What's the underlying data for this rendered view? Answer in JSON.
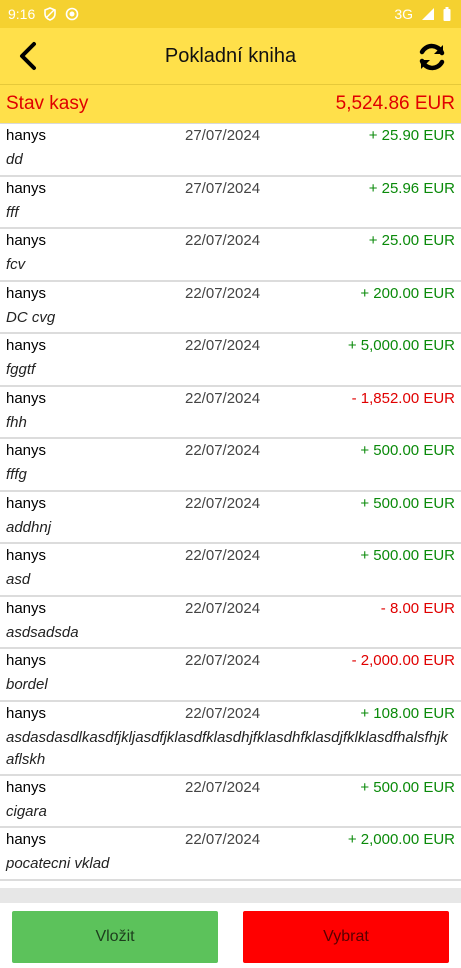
{
  "status_bar": {
    "time": "9:16",
    "network": "3G"
  },
  "header": {
    "title": "Pokladní kniha",
    "back_icon": "arrow-back-icon",
    "refresh_icon": "refresh-icon"
  },
  "balance": {
    "label": "Stav kasy",
    "value": "5,524.86 EUR"
  },
  "entries": [
    {
      "user": "hanys",
      "date": "27/07/2024",
      "amount": "+ 25.90 EUR",
      "type": "pos",
      "note": "dd"
    },
    {
      "user": "hanys",
      "date": "27/07/2024",
      "amount": "+ 25.96 EUR",
      "type": "pos",
      "note": "fff"
    },
    {
      "user": "hanys",
      "date": "22/07/2024",
      "amount": "+ 25.00 EUR",
      "type": "pos",
      "note": "fcv"
    },
    {
      "user": "hanys",
      "date": "22/07/2024",
      "amount": "+ 200.00 EUR",
      "type": "pos",
      "note": "DC cvg"
    },
    {
      "user": "hanys",
      "date": "22/07/2024",
      "amount": "+ 5,000.00 EUR",
      "type": "pos",
      "note": "fggtf"
    },
    {
      "user": "hanys",
      "date": "22/07/2024",
      "amount": "- 1,852.00 EUR",
      "type": "neg",
      "note": "fhh"
    },
    {
      "user": "hanys",
      "date": "22/07/2024",
      "amount": "+ 500.00 EUR",
      "type": "pos",
      "note": "fffg"
    },
    {
      "user": "hanys",
      "date": "22/07/2024",
      "amount": "+ 500.00 EUR",
      "type": "pos",
      "note": "addhnj"
    },
    {
      "user": "hanys",
      "date": "22/07/2024",
      "amount": "+ 500.00 EUR",
      "type": "pos",
      "note": "asd"
    },
    {
      "user": "hanys",
      "date": "22/07/2024",
      "amount": "- 8.00 EUR",
      "type": "neg",
      "note": "asdsadsda"
    },
    {
      "user": "hanys",
      "date": "22/07/2024",
      "amount": "- 2,000.00 EUR",
      "type": "neg",
      "note": "bordel"
    },
    {
      "user": "hanys",
      "date": "22/07/2024",
      "amount": "+ 108.00 EUR",
      "type": "pos",
      "note": "asdasdasdlkasdfjkljasdfjklasdfklasdhjfklasdhfklasdjfklklasdfhalsfhjkaflskh"
    },
    {
      "user": "hanys",
      "date": "22/07/2024",
      "amount": "+ 500.00 EUR",
      "type": "pos",
      "note": "cigara"
    },
    {
      "user": "hanys",
      "date": "22/07/2024",
      "amount": "+ 2,000.00 EUR",
      "type": "pos",
      "note": "pocatecni vklad"
    }
  ],
  "footer": {
    "deposit_label": "Vložit",
    "withdraw_label": "Vybrat"
  },
  "colors": {
    "header": "#ffe04a",
    "positive": "#0a8a0a",
    "negative": "#e00000",
    "deposit_button": "#5cc25b",
    "withdraw_button": "#ff0000"
  }
}
